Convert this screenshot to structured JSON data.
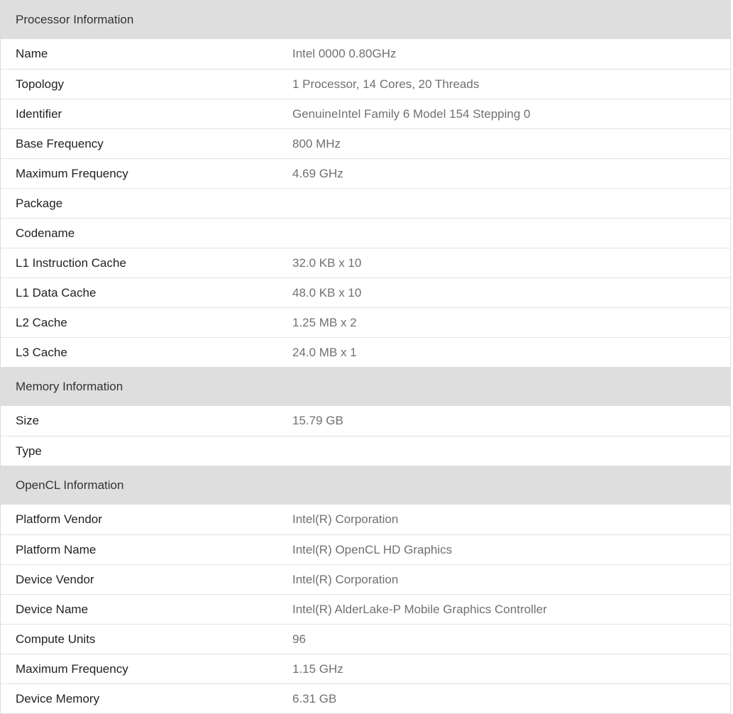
{
  "processor": {
    "header": "Processor Information",
    "rows": [
      {
        "label": "Name",
        "value": "Intel 0000 0.80GHz"
      },
      {
        "label": "Topology",
        "value": "1 Processor, 14 Cores, 20 Threads"
      },
      {
        "label": "Identifier",
        "value": "GenuineIntel Family 6 Model 154 Stepping 0"
      },
      {
        "label": "Base Frequency",
        "value": "800 MHz"
      },
      {
        "label": "Maximum Frequency",
        "value": "4.69 GHz"
      },
      {
        "label": "Package",
        "value": ""
      },
      {
        "label": "Codename",
        "value": ""
      },
      {
        "label": "L1 Instruction Cache",
        "value": "32.0 KB x 10"
      },
      {
        "label": "L1 Data Cache",
        "value": "48.0 KB x 10"
      },
      {
        "label": "L2 Cache",
        "value": "1.25 MB x 2"
      },
      {
        "label": "L3 Cache",
        "value": "24.0 MB x 1"
      }
    ]
  },
  "memory": {
    "header": "Memory Information",
    "rows": [
      {
        "label": "Size",
        "value": "15.79 GB"
      },
      {
        "label": "Type",
        "value": ""
      }
    ]
  },
  "opencl": {
    "header": "OpenCL Information",
    "rows": [
      {
        "label": "Platform Vendor",
        "value": "Intel(R) Corporation"
      },
      {
        "label": "Platform Name",
        "value": "Intel(R) OpenCL HD Graphics"
      },
      {
        "label": "Device Vendor",
        "value": "Intel(R) Corporation"
      },
      {
        "label": "Device Name",
        "value": "Intel(R) AlderLake-P Mobile Graphics Controller"
      },
      {
        "label": "Compute Units",
        "value": "96"
      },
      {
        "label": "Maximum Frequency",
        "value": "1.15 GHz"
      },
      {
        "label": "Device Memory",
        "value": "6.31 GB"
      }
    ]
  }
}
